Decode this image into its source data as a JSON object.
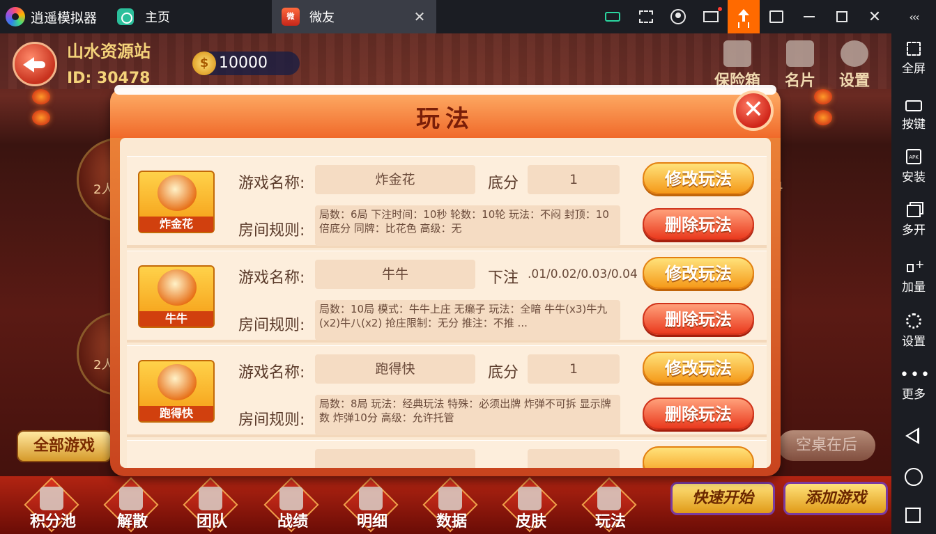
{
  "titlebar": {
    "app_name": "逍遥模拟器",
    "tabs": [
      {
        "label": "主页"
      },
      {
        "label": "微友"
      }
    ],
    "tab_close": "✕",
    "window_controls": [
      "gamepad-icon",
      "screenshot-icon",
      "account-icon",
      "mail-icon",
      "upload-icon",
      "screen-record-icon",
      "minimize-icon",
      "maximize-icon",
      "close-icon",
      "more-icon"
    ],
    "close_glyph": "✕",
    "more_glyph": "‹‹‹",
    "upload_color": "#ff6a00"
  },
  "sidebar": {
    "items": [
      {
        "label": "全屏",
        "icon": "fullscreen-icon"
      },
      {
        "label": "按键",
        "icon": "keyboard-icon"
      },
      {
        "label": "安装",
        "icon": "apk-icon"
      },
      {
        "label": "多开",
        "icon": "multi-instance-icon"
      },
      {
        "label": "加量",
        "icon": "volume-up-icon"
      },
      {
        "label": "设置",
        "icon": "settings-icon"
      },
      {
        "label": "更多",
        "icon": "more-dots-icon"
      }
    ],
    "apk_text": "APK",
    "dots": "•••"
  },
  "game": {
    "club_name": "山水资源站",
    "club_id": "ID: 30478",
    "coins": "10000",
    "coin_glyph": "$",
    "top_icons": [
      {
        "label": "保险箱",
        "icon": "safe-icon"
      },
      {
        "label": "名片",
        "icon": "card-icon"
      },
      {
        "label": "设置",
        "icon": "gear-icon"
      }
    ],
    "seat_labels": [
      "2人",
      "2人",
      "4"
    ],
    "all_games": "全部游戏",
    "empty_last": "空桌在后",
    "bottom_nav": [
      {
        "label": "积分池",
        "icon": "points-pool-icon"
      },
      {
        "label": "解散",
        "icon": "dissolve-icon"
      },
      {
        "label": "团队",
        "icon": "team-icon"
      },
      {
        "label": "战绩",
        "icon": "record-icon"
      },
      {
        "label": "明细",
        "icon": "detail-icon"
      },
      {
        "label": "数据",
        "icon": "data-icon"
      },
      {
        "label": "皮肤",
        "icon": "skin-icon"
      },
      {
        "label": "玩法",
        "icon": "rules-icon"
      }
    ],
    "quick_start": "快速开始",
    "add_game": "添加游戏"
  },
  "modal": {
    "title": "玩法",
    "close_glyph": "✕",
    "name_label": "游戏名称:",
    "rules_label": "房间规则:",
    "edit_button": "修改玩法",
    "delete_button": "删除玩法",
    "rules": [
      {
        "icon_label": "炸金花",
        "game_name": "炸金花",
        "extra_label": "底分",
        "extra_value": "1",
        "room_rules": "局数：6局  下注时间：10秒 轮数：10轮 玩法：不闷 封顶：10倍底分 同牌：比花色 高级：无"
      },
      {
        "icon_label": "牛牛",
        "game_name": "牛牛",
        "extra_label": "下注",
        "extra_value": ".01/0.02/0.03/0.04",
        "room_rules": "局数：10局  模式：牛牛上庄 无癞子 玩法：全暗 牛牛(x3)牛九(x2)牛八(x2) 抢庄限制：无分  推注：不推  ..."
      },
      {
        "icon_label": "跑得快",
        "game_name": "跑得快",
        "extra_label": "底分",
        "extra_value": "1",
        "room_rules": "局数：8局  玩法：经典玩法 特殊：必须出牌 炸弹不可拆 显示牌数 炸弹10分 高级：允许托管"
      }
    ]
  }
}
